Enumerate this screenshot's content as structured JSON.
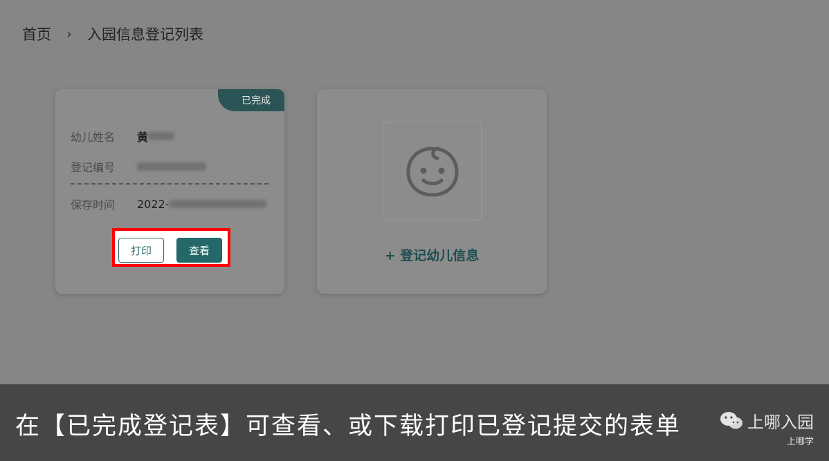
{
  "breadcrumb": {
    "home": "首页",
    "separator": "›",
    "current": "入园信息登记列表"
  },
  "record_card": {
    "status": "已完成",
    "fields": [
      {
        "label": "幼儿姓名",
        "value": "黄"
      },
      {
        "label": "登记编号",
        "value": ""
      },
      {
        "label": "保存时间",
        "value": "2022-"
      }
    ],
    "buttons": {
      "print": "打印",
      "view": "查看"
    }
  },
  "add_card": {
    "icon": "baby-face-icon",
    "link": "+ 登记幼儿信息"
  },
  "caption": {
    "text": "在【已完成登记表】可查看、或下载打印已登记提交的表单",
    "watermark_main": "上哪入园",
    "watermark_sub": "上哪学",
    "watermark_icon": "wechat-icon"
  },
  "colors": {
    "accent": "#24686a",
    "highlight": "#ff0000",
    "overlay": "#868686"
  }
}
